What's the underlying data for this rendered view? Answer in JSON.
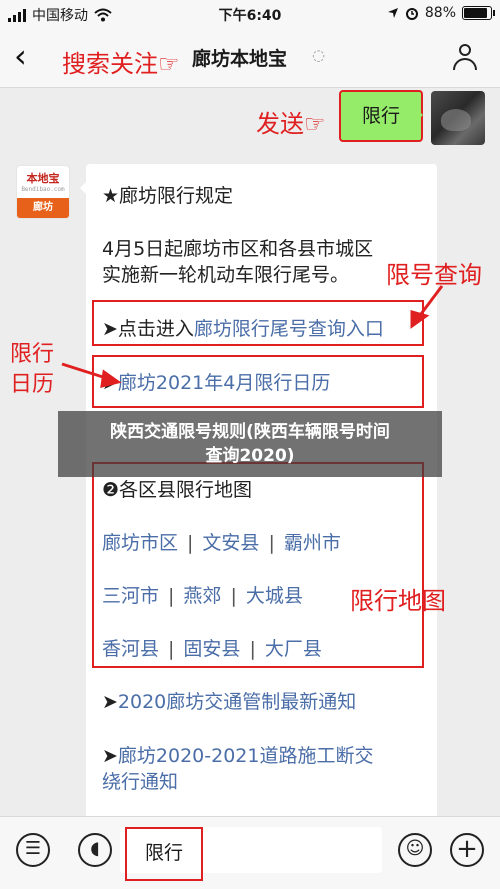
{
  "status_bar": {
    "carrier": "中国移动",
    "time": "下午6:40",
    "battery_percent": "88%",
    "battery_level": 0.88
  },
  "nav": {
    "back_icon": "chevron-left-icon",
    "title": "廊坊本地宝",
    "ear_icon": "ear-icon",
    "profile_icon": "person-icon"
  },
  "annotations": {
    "search_follow": "搜索关注☞",
    "send": "发送☞",
    "plate_query": "限号查询",
    "restriction_calendar_1": "限行",
    "restriction_calendar_2": "日历",
    "restriction_map": "限行地图"
  },
  "sent_message": "限行",
  "logo": {
    "top": "本地宝",
    "url": "Bendibao.com",
    "city": "廊坊"
  },
  "card": {
    "heading": "★廊坊限行规定",
    "intro_1": "4月5日起廊坊市区和各县市城区",
    "intro_2": "实施新一轮机动车限行尾号。",
    "entry_prefix": "➤点击进入",
    "entry_link": "廊坊限行尾号查询入口",
    "calendar_prefix": "➤",
    "calendar_link": "廊坊2021年4月限行日历",
    "map_heading": "❷各区县限行地图",
    "districts": [
      [
        "廊坊市区",
        "文安县",
        "霸州市"
      ],
      [
        "三河市",
        "燕郊",
        "大城县"
      ],
      [
        "香河县",
        "固安县",
        "大厂县"
      ]
    ],
    "separator": "|",
    "news_prefix": "➤",
    "news_link": "2020廊坊交通管制最新通知",
    "road_prefix": "➤",
    "road_link_1": "廊坊2020-2021道路施工断交",
    "road_link_2": "绕行通知"
  },
  "caption": {
    "line1": "陕西交通限号规则(陕西车辆限号时间",
    "line2": "查询2020)"
  },
  "input_bar": {
    "value": "限行",
    "icons": [
      "menu-list-icon",
      "voice-icon",
      "emoji-icon",
      "plus-icon"
    ]
  }
}
